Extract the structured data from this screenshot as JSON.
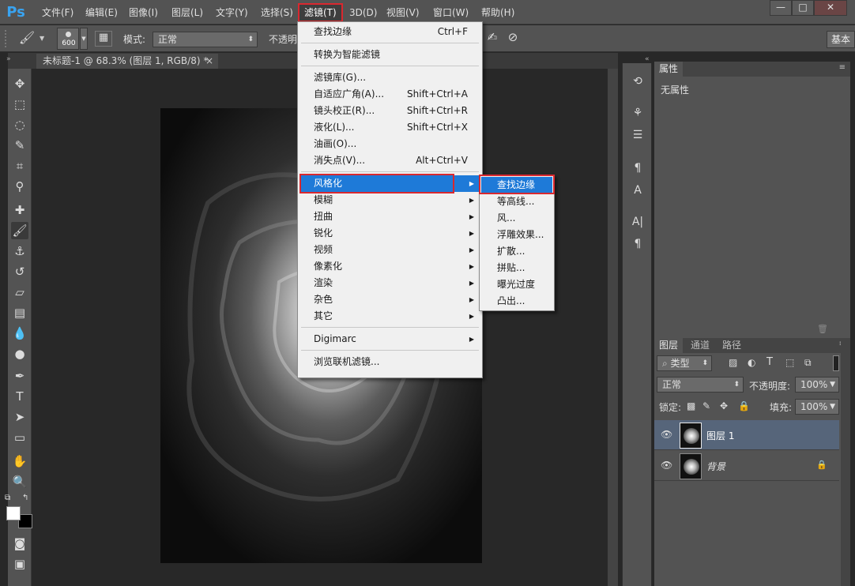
{
  "app": {
    "logo": "Ps"
  },
  "menubar": {
    "items": [
      "文件(F)",
      "编辑(E)",
      "图像(I)",
      "图层(L)",
      "文字(Y)",
      "选择(S)",
      "滤镜(T)",
      "3D(D)",
      "视图(V)",
      "窗口(W)",
      "帮助(H)"
    ],
    "active_index": 6
  },
  "window_controls": {
    "minimize": "—",
    "restore": "□",
    "close": "✕"
  },
  "options_bar": {
    "brush_size": "600",
    "mode_label": "模式:",
    "mode_value": "正常",
    "opacity_label": "不透明",
    "workspace_btn": "基本"
  },
  "document_tab": {
    "title": "未标题-1 @ 68.3% (图层 1, RGB/8) *",
    "close": "×"
  },
  "filter_menu": {
    "items": [
      {
        "label": "查找边缘",
        "shortcut": "Ctrl+F"
      },
      {
        "sep": true
      },
      {
        "label": "转换为智能滤镜"
      },
      {
        "sep": true
      },
      {
        "label": "滤镜库(G)..."
      },
      {
        "label": "自适应广角(A)...",
        "shortcut": "Shift+Ctrl+A"
      },
      {
        "label": "镜头校正(R)...",
        "shortcut": "Shift+Ctrl+R"
      },
      {
        "label": "液化(L)...",
        "shortcut": "Shift+Ctrl+X"
      },
      {
        "label": "油画(O)..."
      },
      {
        "label": "消失点(V)...",
        "shortcut": "Alt+Ctrl+V"
      },
      {
        "sep": true
      },
      {
        "label": "风格化",
        "submenu": true,
        "highlight": true
      },
      {
        "label": "模糊",
        "submenu": true
      },
      {
        "label": "扭曲",
        "submenu": true
      },
      {
        "label": "锐化",
        "submenu": true
      },
      {
        "label": "视频",
        "submenu": true
      },
      {
        "label": "像素化",
        "submenu": true
      },
      {
        "label": "渲染",
        "submenu": true
      },
      {
        "label": "杂色",
        "submenu": true
      },
      {
        "label": "其它",
        "submenu": true
      },
      {
        "sep": true
      },
      {
        "label": "Digimarc",
        "submenu": true
      },
      {
        "sep": true
      },
      {
        "label": "浏览联机滤镜..."
      }
    ]
  },
  "stylize_submenu": {
    "items": [
      "查找边缘",
      "等高线...",
      "风...",
      "浮雕效果...",
      "扩散...",
      "拼贴...",
      "曝光过度",
      "凸出..."
    ],
    "highlight_index": 0
  },
  "properties_panel": {
    "title": "属性",
    "empty_text": "无属性"
  },
  "layers_panel": {
    "tabs": [
      "图层",
      "通道",
      "路径"
    ],
    "filter_kind": "类型",
    "blend_mode": "正常",
    "opacity_label": "不透明度:",
    "opacity_value": "100%",
    "lock_label": "锁定:",
    "fill_label": "填充:",
    "fill_value": "100%",
    "layers": [
      {
        "name": "图层 1",
        "selected": true,
        "locked": false
      },
      {
        "name": "背景",
        "selected": false,
        "locked": true
      }
    ]
  },
  "colors": {
    "accent": "#1e7ad8",
    "highlight_box": "#d9282f",
    "panel_bg": "#535353",
    "selected_layer": "#56657a"
  }
}
